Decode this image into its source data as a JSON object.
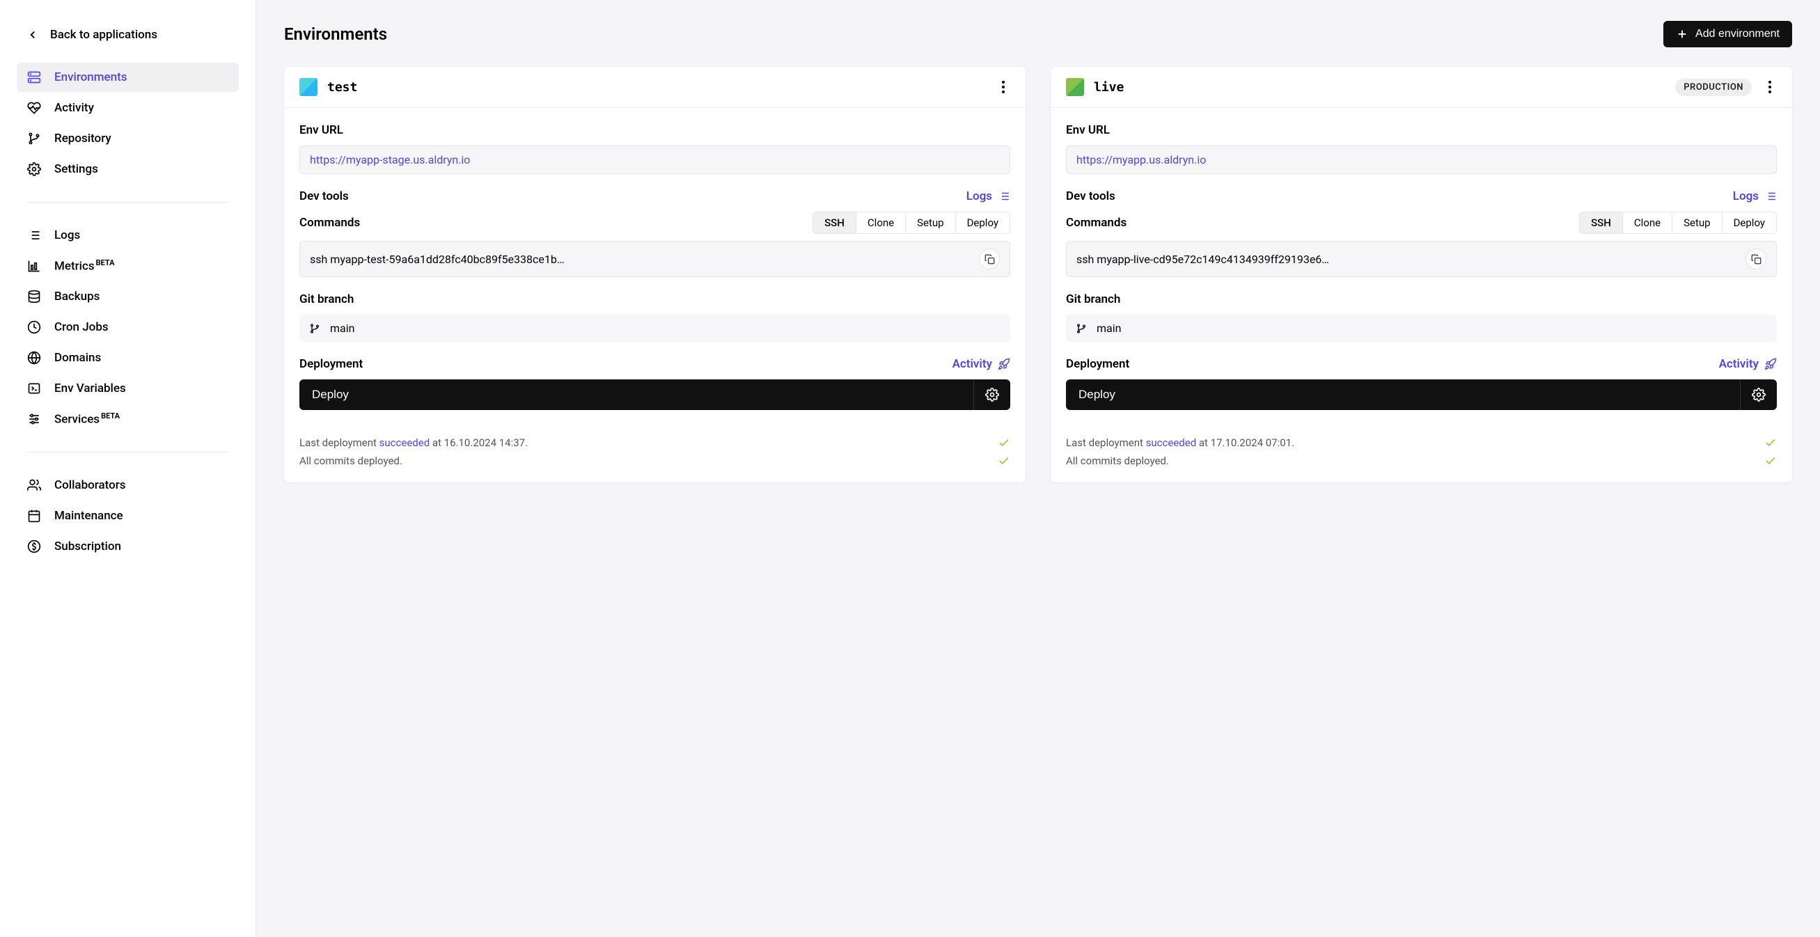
{
  "backLink": "Back to applications",
  "nav": {
    "group1": [
      {
        "label": "Environments",
        "active": true
      },
      {
        "label": "Activity"
      },
      {
        "label": "Repository"
      },
      {
        "label": "Settings"
      }
    ],
    "group2": [
      {
        "label": "Logs"
      },
      {
        "label": "Metrics",
        "beta": "BETA"
      },
      {
        "label": "Backups"
      },
      {
        "label": "Cron Jobs"
      },
      {
        "label": "Domains"
      },
      {
        "label": "Env Variables"
      },
      {
        "label": "Services",
        "beta": "BETA"
      }
    ],
    "group3": [
      {
        "label": "Collaborators"
      },
      {
        "label": "Maintenance"
      },
      {
        "label": "Subscription"
      }
    ]
  },
  "page": {
    "title": "Environments",
    "addButton": "Add environment"
  },
  "labels": {
    "envUrl": "Env URL",
    "devTools": "Dev tools",
    "logs": "Logs",
    "commands": "Commands",
    "gitBranch": "Git branch",
    "deployment": "Deployment",
    "activity": "Activity",
    "deployBtn": "Deploy",
    "lastDeployPrefix": "Last deployment ",
    "lastDeploySuffixAt": " at ",
    "allCommits": "All commits deployed.",
    "succeeded": "succeeded",
    "production": "PRODUCTION"
  },
  "cmdTabs": [
    "SSH",
    "Clone",
    "Setup",
    "Deploy"
  ],
  "envs": [
    {
      "id": "test",
      "name": "test",
      "badge": null,
      "url": "https://myapp-stage.us.aldryn.io",
      "ssh": "ssh myapp-test-59a6a1dd28fc40bc89f5e338ce1b…",
      "branch": "main",
      "lastDeployTime": "16.10.2024 14:37."
    },
    {
      "id": "live",
      "name": "live",
      "badge": "PRODUCTION",
      "url": "https://myapp.us.aldryn.io",
      "ssh": "ssh myapp-live-cd95e72c149c4134939ff29193e6…",
      "branch": "main",
      "lastDeployTime": "17.10.2024 07:01."
    }
  ]
}
